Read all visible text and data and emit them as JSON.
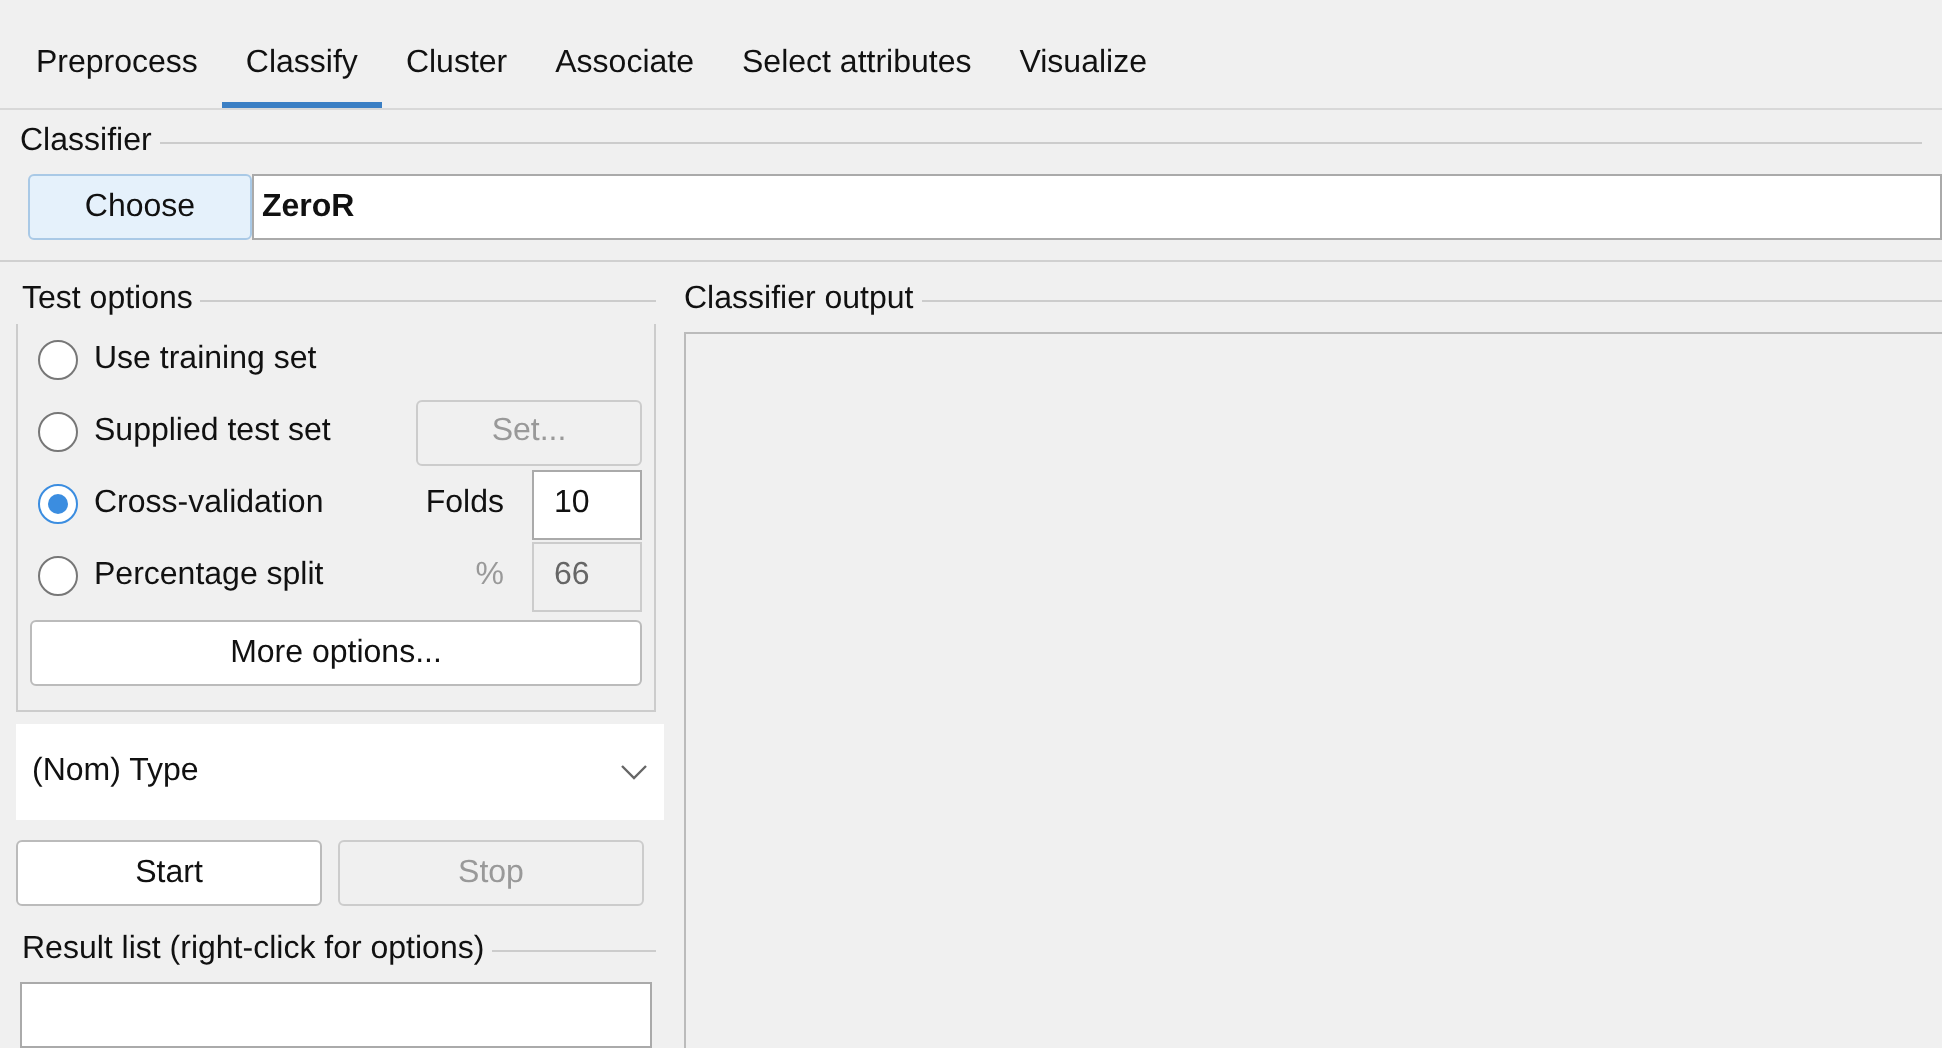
{
  "tabs": [
    {
      "label": "Preprocess",
      "selected": false
    },
    {
      "label": "Classify",
      "selected": true
    },
    {
      "label": "Cluster",
      "selected": false
    },
    {
      "label": "Associate",
      "selected": false
    },
    {
      "label": "Select attributes",
      "selected": false
    },
    {
      "label": "Visualize",
      "selected": false
    }
  ],
  "classifier": {
    "title": "Classifier",
    "button": "Choose",
    "value": "ZeroR"
  },
  "test_options": {
    "title": "Test options",
    "options": [
      {
        "label": "Use training set",
        "selected": false
      },
      {
        "label": "Supplied test set",
        "selected": false,
        "control": {
          "kind": "button",
          "label": "Set...",
          "disabled": true
        }
      },
      {
        "label": "Cross-validation",
        "selected": true,
        "control": {
          "kind": "field",
          "label": "Folds",
          "value": "10",
          "disabled": false
        }
      },
      {
        "label": "Percentage split",
        "selected": false,
        "control": {
          "kind": "field",
          "label": "%",
          "value": "66",
          "disabled": true
        }
      }
    ],
    "more_button": "More options..."
  },
  "class_select": {
    "value": "(Nom) Type"
  },
  "start_button": {
    "label": "Start",
    "disabled": false
  },
  "stop_button": {
    "label": "Stop",
    "disabled": true
  },
  "result_list": {
    "title": "Result list (right-click for options)"
  },
  "output": {
    "title": "Classifier output"
  }
}
